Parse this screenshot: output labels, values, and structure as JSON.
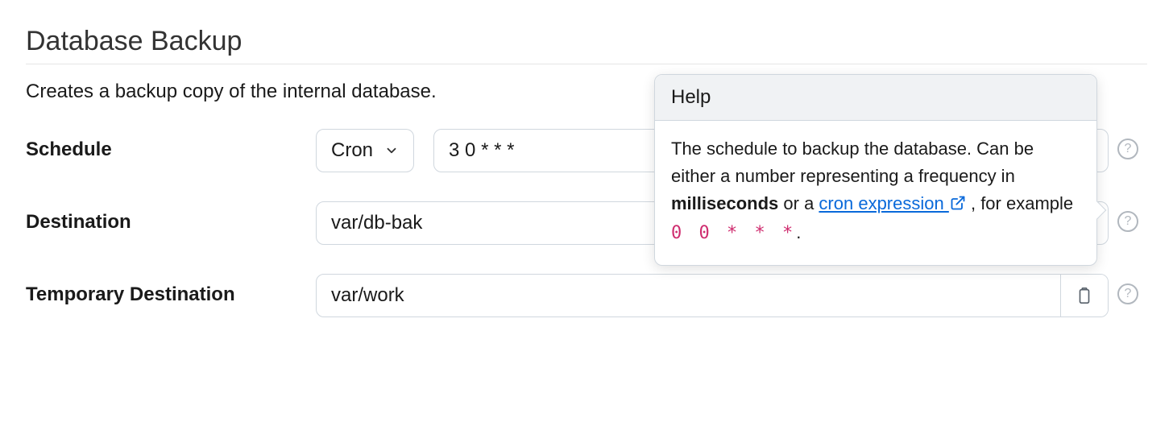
{
  "section": {
    "title": "Database Backup",
    "description": "Creates a backup copy of the internal database."
  },
  "form": {
    "schedule": {
      "label": "Schedule",
      "type_selected": "Cron",
      "value": "3 0 * * *"
    },
    "destination": {
      "label": "Destination",
      "value": "var/db-bak"
    },
    "temp_destination": {
      "label": "Temporary Destination",
      "value": "var/work"
    }
  },
  "tooltip": {
    "title": "Help",
    "text_part1": "The schedule to backup the database. Can be either a number representing a frequency in ",
    "text_bold": "milliseconds",
    "text_part2": " or a ",
    "link_text": "cron expression ",
    "text_part3": ", for example ",
    "code_example": "0 0 * * *",
    "text_end": "."
  }
}
